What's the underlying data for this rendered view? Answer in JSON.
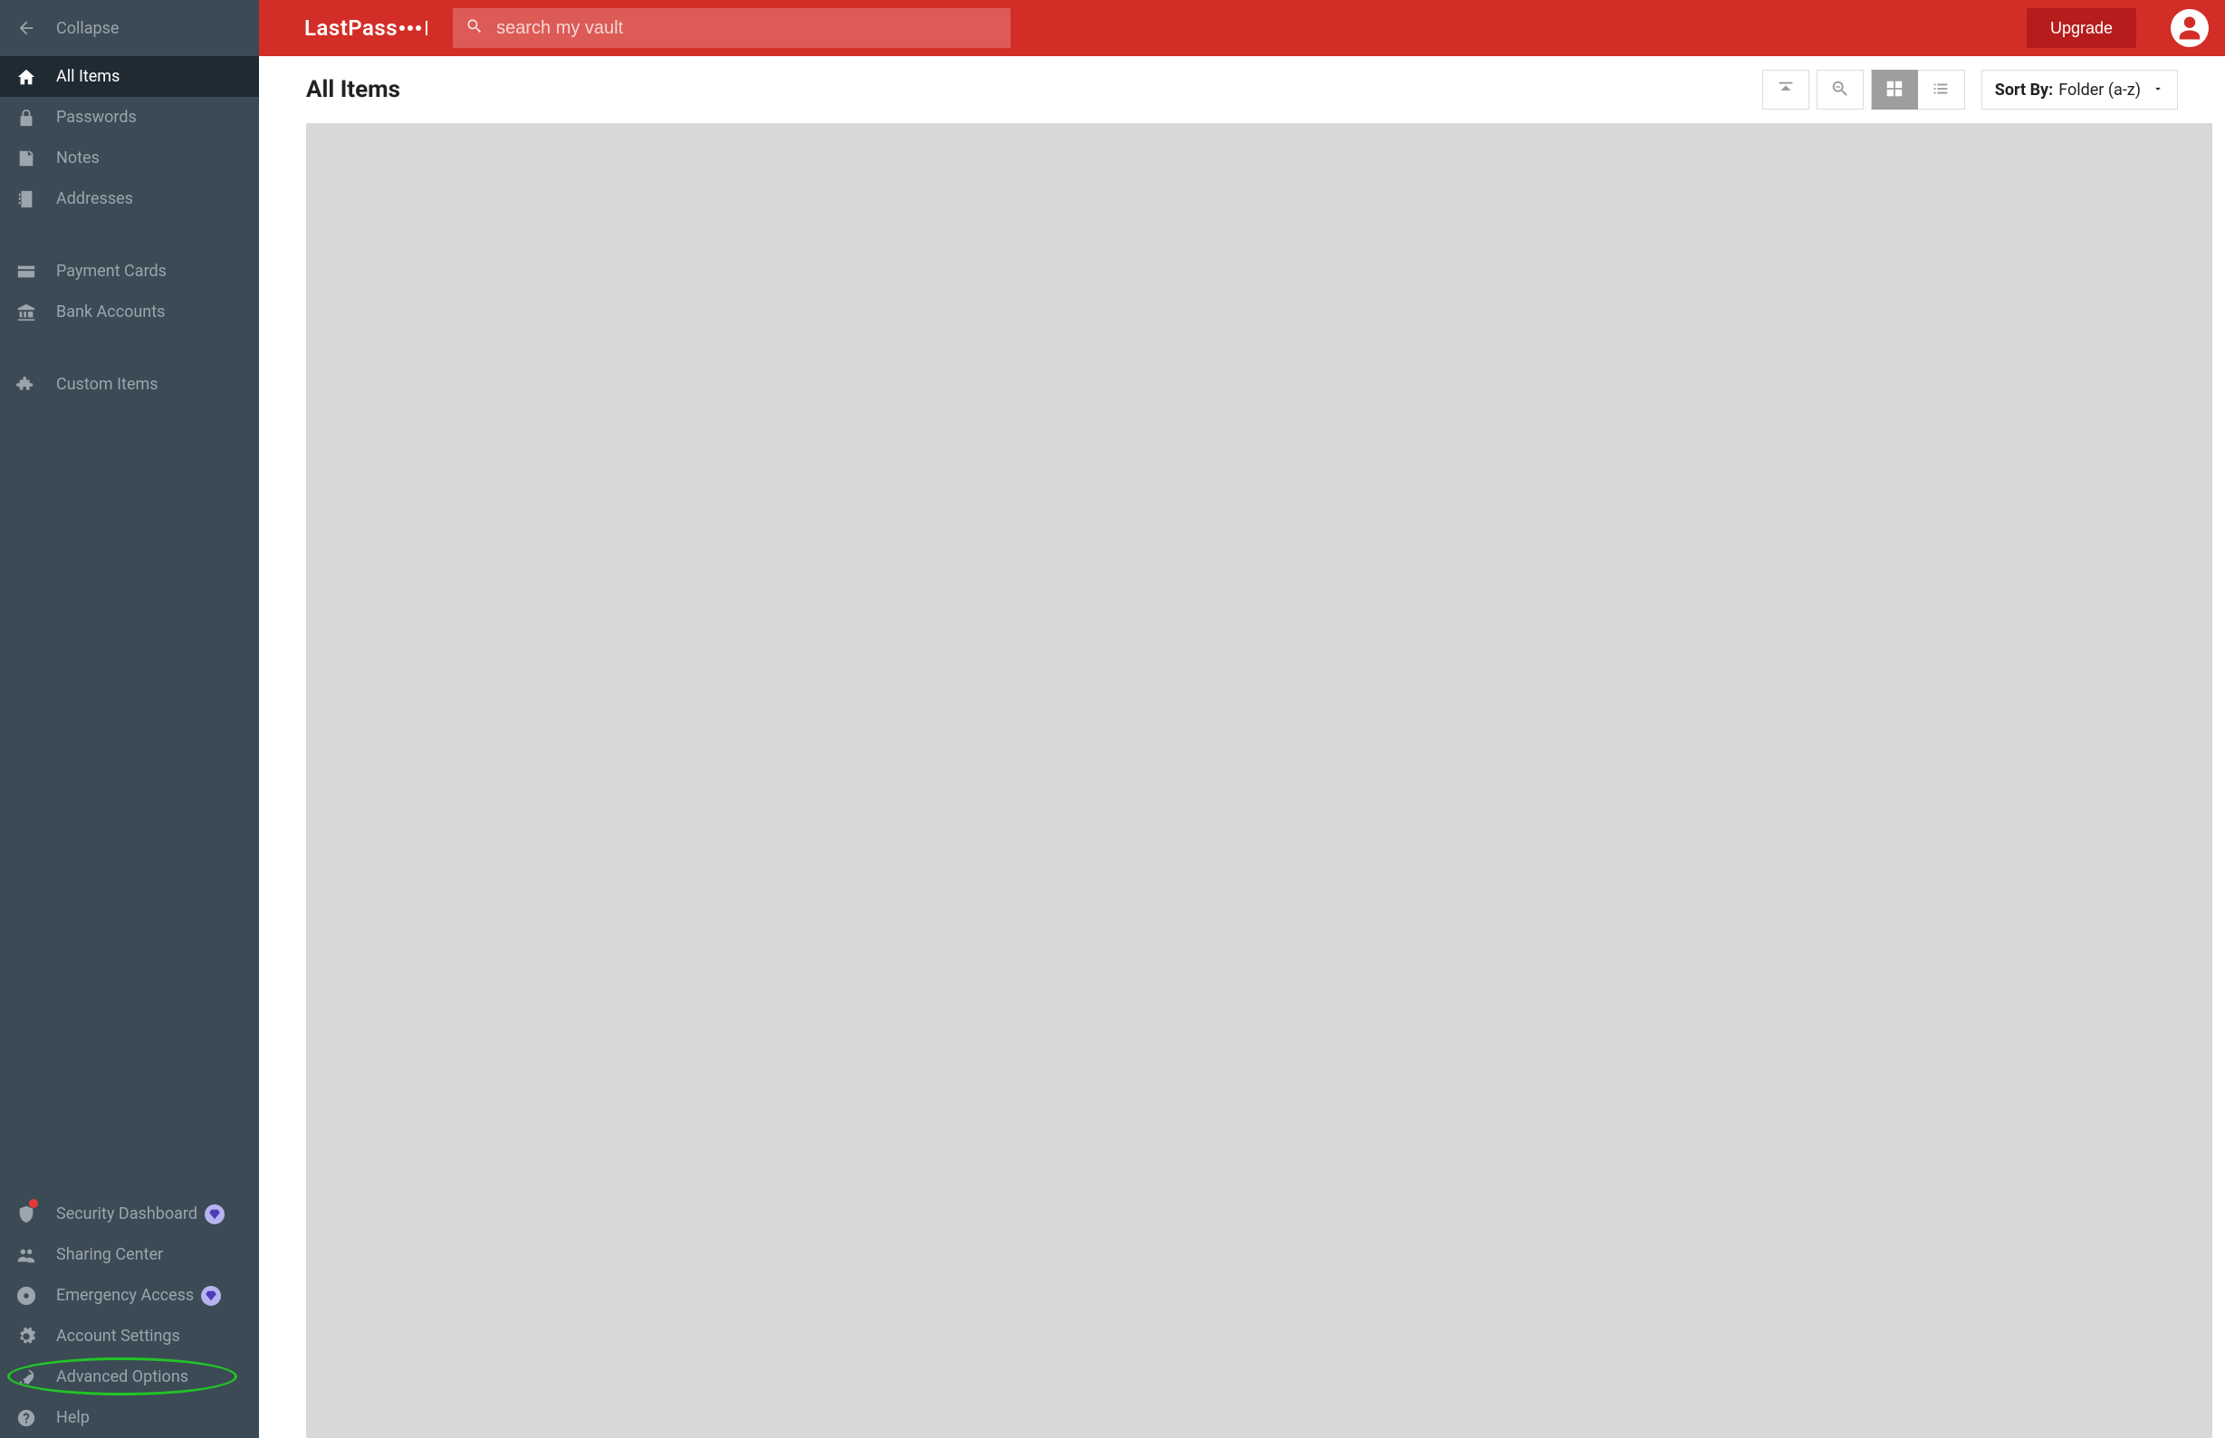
{
  "sidebar": {
    "collapse": "Collapse",
    "items_top": [
      {
        "id": "all-items",
        "label": "All Items",
        "icon": "home",
        "active": true
      },
      {
        "id": "passwords",
        "label": "Passwords",
        "icon": "lock"
      },
      {
        "id": "notes",
        "label": "Notes",
        "icon": "note"
      },
      {
        "id": "addresses",
        "label": "Addresses",
        "icon": "addressbook"
      }
    ],
    "items_mid": [
      {
        "id": "payment-cards",
        "label": "Payment Cards",
        "icon": "card"
      },
      {
        "id": "bank-accounts",
        "label": "Bank Accounts",
        "icon": "bank"
      }
    ],
    "items_mid2": [
      {
        "id": "custom-items",
        "label": "Custom Items",
        "icon": "puzzle"
      }
    ],
    "items_bottom": [
      {
        "id": "security-dashboard",
        "label": "Security Dashboard",
        "icon": "shield",
        "diamond": true,
        "notify": true
      },
      {
        "id": "sharing-center",
        "label": "Sharing Center",
        "icon": "people"
      },
      {
        "id": "emergency-access",
        "label": "Emergency Access",
        "icon": "lifebuoy",
        "diamond": true
      },
      {
        "id": "account-settings",
        "label": "Account Settings",
        "icon": "gear"
      },
      {
        "id": "advanced-options",
        "label": "Advanced Options",
        "icon": "rocket",
        "highlight": true
      },
      {
        "id": "help",
        "label": "Help",
        "icon": "help"
      }
    ]
  },
  "header": {
    "logo_text": "LastPass",
    "search_placeholder": "search my vault",
    "upgrade_label": "Upgrade"
  },
  "toolbar": {
    "title": "All Items",
    "sort_label": "Sort By:",
    "sort_value": "Folder (a-z)"
  }
}
